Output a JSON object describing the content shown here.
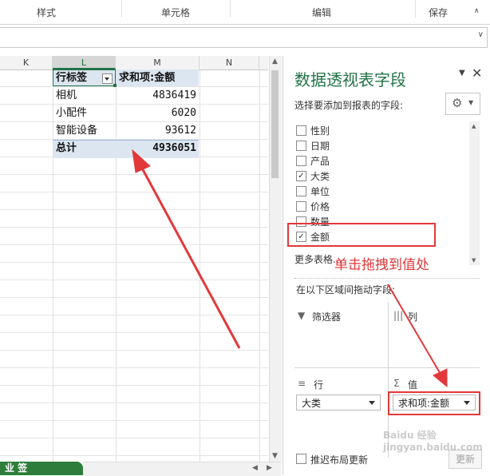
{
  "ribbon": {
    "groups": [
      "样式",
      "单元格",
      "编辑",
      "保存"
    ]
  },
  "sheet": {
    "columns": [
      "K",
      "L",
      "M",
      "N"
    ],
    "pivot": {
      "header_row_label": "行标签",
      "header_value": "求和项:金额",
      "rows": [
        {
          "label": "相机",
          "value": "4836419"
        },
        {
          "label": "小配件",
          "value": "6020"
        },
        {
          "label": "智能设备",
          "value": "93612"
        }
      ],
      "total_label": "总计",
      "total_value": "4936051"
    },
    "sheet_tab": "业 签"
  },
  "panel": {
    "title": "数据透视表字段",
    "subtitle": "选择要添加到报表的字段:",
    "fields": [
      {
        "label": "性别",
        "checked": false
      },
      {
        "label": "日期",
        "checked": false
      },
      {
        "label": "产品",
        "checked": false
      },
      {
        "label": "大类",
        "checked": true
      },
      {
        "label": "单位",
        "checked": false
      },
      {
        "label": "价格",
        "checked": false
      },
      {
        "label": "数量",
        "checked": false
      },
      {
        "label": "金额",
        "checked": true
      }
    ],
    "more_tables": "更多表格...",
    "drag_hint": "在以下区域间拖动字段:",
    "filters_label": "筛选器",
    "columns_label": "列",
    "rows_label": "行",
    "values_label": "值",
    "rows_value": "大类",
    "values_value": "求和项:金额",
    "defer_label": "推迟布局更新",
    "update_label": "更新"
  },
  "annotation": {
    "text": "单击拖拽到值处",
    "color": "#e2383a"
  },
  "watermark": "Baidu 经验 jingyan.baidu.com"
}
